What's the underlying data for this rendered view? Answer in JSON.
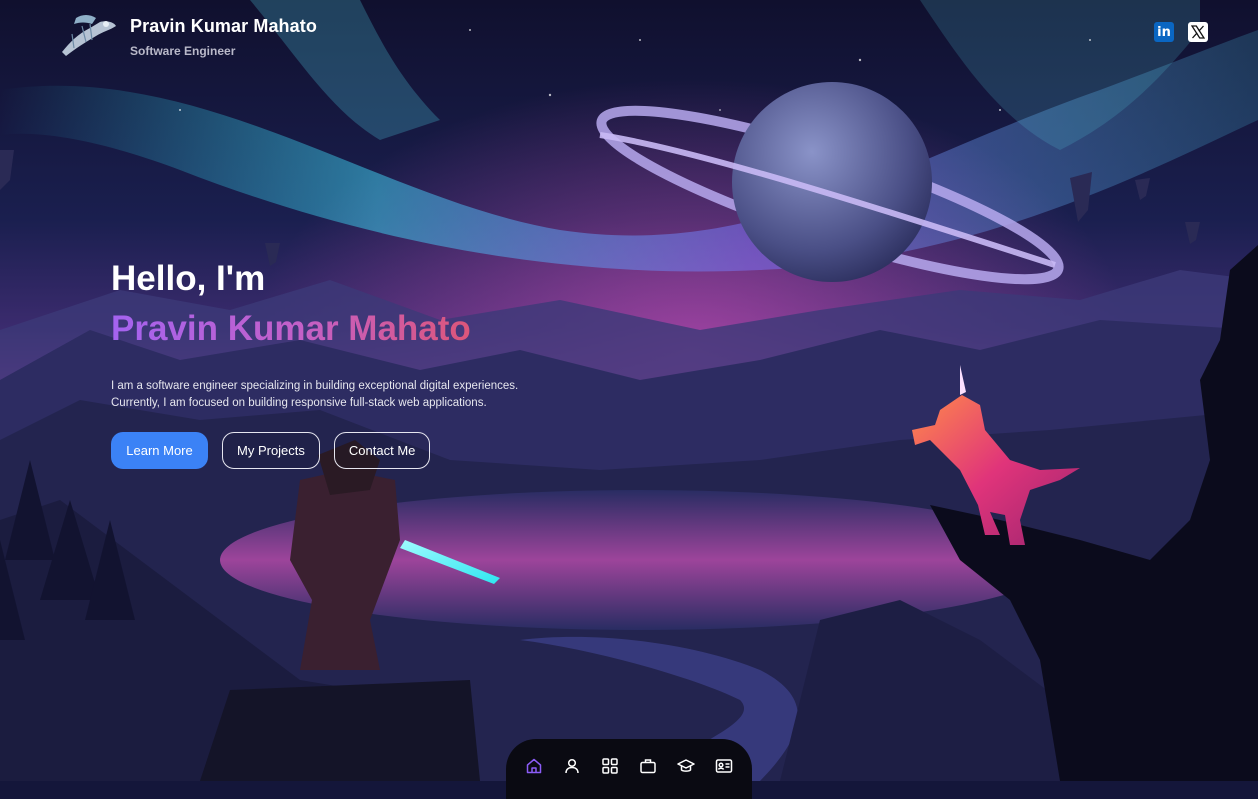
{
  "header": {
    "name": "Pravin Kumar Mahato",
    "role": "Software Engineer",
    "logo_icon": "flying-ship-logo-icon"
  },
  "socials": [
    {
      "name": "LinkedIn",
      "icon": "linkedin-icon",
      "glyph": "in"
    },
    {
      "name": "X",
      "icon": "x-icon"
    }
  ],
  "hero": {
    "greeting": "Hello, I'm",
    "name": "Pravin Kumar Mahato",
    "description": "I am a software engineer specializing in building exceptional digital experiences. Currently, I am focused on building responsive full-stack web applications.",
    "buttons": {
      "learn_more": "Learn More",
      "projects": "My Projects",
      "contact": "Contact Me"
    }
  },
  "dock": {
    "items": [
      "home-icon",
      "user-icon",
      "grid-icon",
      "briefcase-icon",
      "graduation-cap-icon",
      "contact-card-icon"
    ],
    "active": "home-icon"
  },
  "colors": {
    "accent": "#3b82f6",
    "name_gradient_start": "#a463f0",
    "name_gradient_end": "#e5525e",
    "active_nav": "#8b5cf6"
  }
}
